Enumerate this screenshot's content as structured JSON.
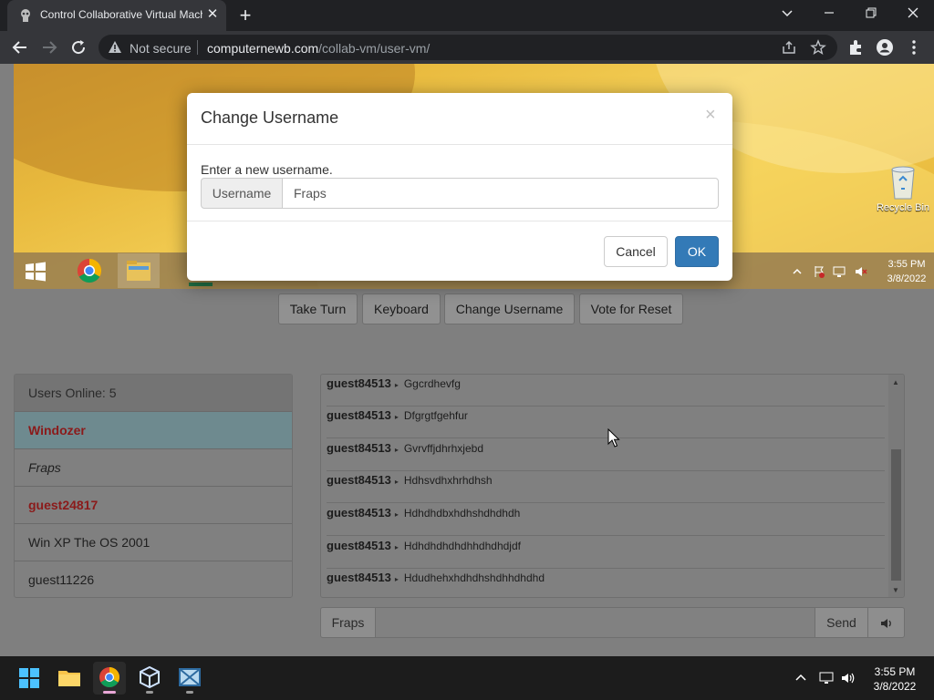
{
  "browser": {
    "tab_title": "Control Collaborative Virtual Machine",
    "security_label": "Not secure",
    "url_domain": "computernewb.com",
    "url_path": "/collab-vm/user-vm/"
  },
  "vm": {
    "recycle_bin_label": "Recycle Bin",
    "clock_time": "3:55 PM",
    "clock_date": "3/8/2022"
  },
  "controls": {
    "take_turn": "Take Turn",
    "keyboard": "Keyboard",
    "change_username": "Change Username",
    "vote_reset": "Vote for Reset"
  },
  "users": {
    "header": "Users Online: 5",
    "list": [
      {
        "name": "Windozer",
        "style": "admin"
      },
      {
        "name": "Fraps",
        "style": "self"
      },
      {
        "name": "guest24817",
        "style": "mod"
      },
      {
        "name": "Win XP The OS 2001",
        "style": "normal"
      },
      {
        "name": "guest11226",
        "style": "normal"
      }
    ]
  },
  "chat": {
    "messages": [
      {
        "user": "guest84513",
        "text": "Ggcrdhevfg"
      },
      {
        "user": "guest84513",
        "text": "Dfgrgtfgehfur"
      },
      {
        "user": "guest84513",
        "text": "Gvrvffjdhrhxjebd"
      },
      {
        "user": "guest84513",
        "text": "Hdhsvdhxhrhdhsh"
      },
      {
        "user": "guest84513",
        "text": "Hdhdhdbxhdhshdhdhdh"
      },
      {
        "user": "guest84513",
        "text": "Hdhdhdhdhdhhdhdhdjdf"
      },
      {
        "user": "guest84513",
        "text": "Hdudhehxhdhdhshdhhdhdhd"
      }
    ],
    "input_label": "Fraps",
    "input_value": "",
    "send_label": "Send"
  },
  "modal": {
    "title": "Change Username",
    "close_glyph": "×",
    "prompt": "Enter a new username.",
    "addon_label": "Username",
    "input_value": "Fraps",
    "cancel_label": "Cancel",
    "ok_label": "OK"
  },
  "taskbar": {
    "time": "3:55 PM",
    "date": "3/8/2022"
  },
  "colors": {
    "modal_primary": "#337ab7",
    "admin_user": "#b71c1c",
    "mod_user": "#b71c1c",
    "active_tab_indicator": "#e9a7d7"
  }
}
